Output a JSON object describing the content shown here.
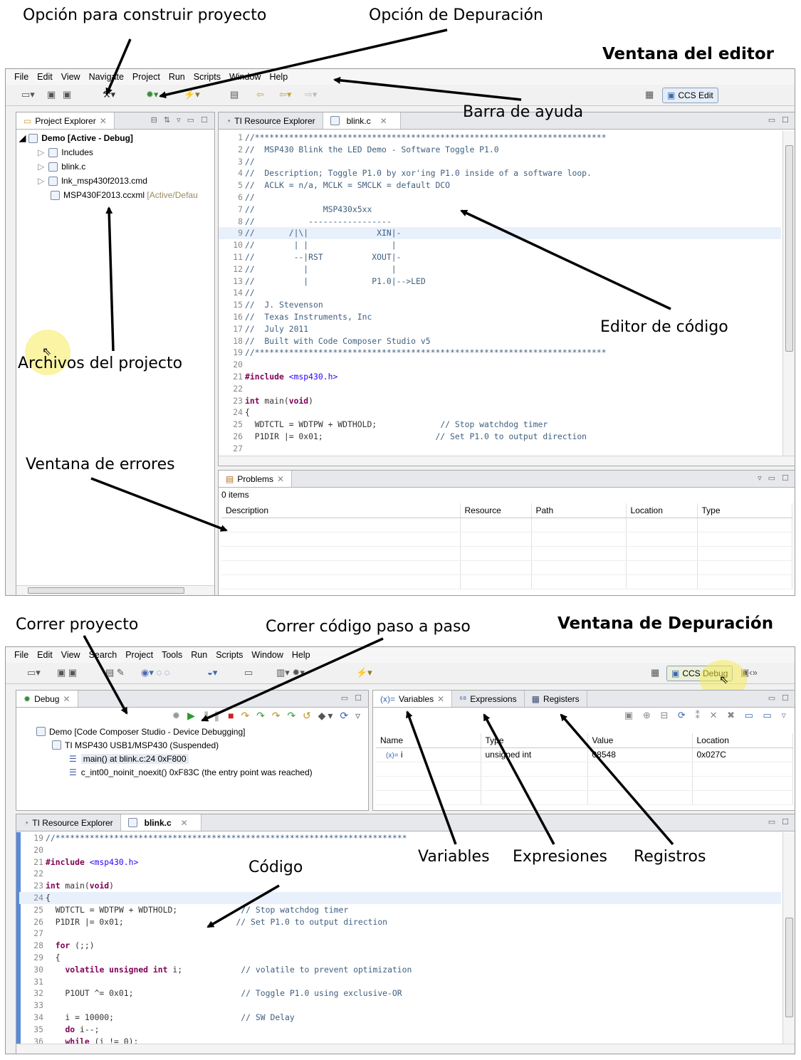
{
  "annotations": {
    "build_option": "Opción para construir proyecto",
    "debug_option": "Opción de Depuración",
    "editor_window": "Ventana del editor",
    "help_bar": "Barra de ayuda",
    "code_editor": "Editor de código",
    "project_files": "Archivos del projecto",
    "errors_window": "Ventana de errores",
    "run_project": "Correr proyecto",
    "step_code": "Correr código paso a paso",
    "debug_window": "Ventana de Depuración",
    "variables": "Variables",
    "expressions": "Expresiones",
    "registers": "Registros",
    "code": "Código"
  },
  "editor": {
    "menu": [
      "File",
      "Edit",
      "View",
      "Navigate",
      "Project",
      "Run",
      "Scripts",
      "Window",
      "Help"
    ],
    "perspective": "CCS Edit",
    "explorer_tab": "Project Explorer",
    "project_root": "Demo  [Active - Debug]",
    "tree": [
      "Includes",
      "blink.c",
      "lnk_msp430f2013.cmd",
      "MSP430F2013.ccxml"
    ],
    "tree_suffix": "[Active/Defau",
    "tab_resource": "TI Resource Explorer",
    "tab_file": "blink.c",
    "code_lines": [
      [
        "1",
        "//************************************************************************"
      ],
      [
        "2",
        "//  MSP430 Blink the LED Demo - Software Toggle P1.0"
      ],
      [
        "3",
        "//"
      ],
      [
        "4",
        "//  Description; Toggle P1.0 by xor'ing P1.0 inside of a software loop."
      ],
      [
        "5",
        "//  ACLK = n/a, MCLK = SMCLK = default DCO"
      ],
      [
        "6",
        "//"
      ],
      [
        "7",
        "//              MSP430x5xx"
      ],
      [
        "8",
        "//           -----------------"
      ],
      [
        "9",
        "//       /|\\|              XIN|-"
      ],
      [
        "10",
        "//        | |                 |"
      ],
      [
        "11",
        "//        --|RST          XOUT|-"
      ],
      [
        "12",
        "//          |                 |"
      ],
      [
        "13",
        "//          |             P1.0|-->LED"
      ],
      [
        "14",
        "//"
      ],
      [
        "15",
        "//  J. Stevenson"
      ],
      [
        "16",
        "//  Texas Instruments, Inc"
      ],
      [
        "17",
        "//  July 2011"
      ],
      [
        "18",
        "//  Built with Code Composer Studio v5"
      ],
      [
        "19",
        "//************************************************************************"
      ],
      [
        "20",
        ""
      ],
      [
        "21",
        "#include <msp430.h>"
      ],
      [
        "22",
        ""
      ],
      [
        "23",
        "int main(void)"
      ],
      [
        "24",
        "{"
      ],
      [
        "25",
        "  WDTCTL = WDTPW + WDTHOLD;             // Stop watchdog timer"
      ],
      [
        "26",
        "  P1DIR |= 0x01;                       // Set P1.0 to output direction"
      ],
      [
        "27",
        ""
      ]
    ],
    "problems_tab": "Problems",
    "problems_count": "0 items",
    "problems_cols": [
      "Description",
      "Resource",
      "Path",
      "Location",
      "Type"
    ]
  },
  "debug": {
    "menu": [
      "File",
      "Edit",
      "View",
      "Search",
      "Project",
      "Tools",
      "Run",
      "Scripts",
      "Window",
      "Help"
    ],
    "perspective": "CCS Debug",
    "debug_tab": "Debug",
    "tree": [
      "Demo [Code Composer Studio - Device Debugging]",
      "TI MSP430 USB1/MSP430 (Suspended)",
      "main() at blink.c:24 0xF800",
      "c_int00_noinit_noexit() 0xF83C  (the entry point was reached)"
    ],
    "tab_variables": "Variables",
    "tab_expressions": "Expressions",
    "tab_registers": "Registers",
    "var_cols": [
      "Name",
      "Type",
      "Value",
      "Location"
    ],
    "var_row": [
      "i",
      "unsigned int",
      "08548",
      "0x027C"
    ],
    "tab_resource": "TI Resource Explorer",
    "tab_file": "blink.c",
    "code_lines": [
      [
        "19",
        "//************************************************************************"
      ],
      [
        "20",
        ""
      ],
      [
        "21",
        "#include <msp430.h>"
      ],
      [
        "22",
        ""
      ],
      [
        "23",
        "int main(void)"
      ],
      [
        "24",
        "{"
      ],
      [
        "25",
        "  WDTCTL = WDTPW + WDTHOLD;             // Stop watchdog timer"
      ],
      [
        "26",
        "  P1DIR |= 0x01;                       // Set P1.0 to output direction"
      ],
      [
        "27",
        ""
      ],
      [
        "28",
        "  for (;;)"
      ],
      [
        "29",
        "  {"
      ],
      [
        "30",
        "    volatile unsigned int i;            // volatile to prevent optimization"
      ],
      [
        "31",
        ""
      ],
      [
        "32",
        "    P1OUT ^= 0x01;                      // Toggle P1.0 using exclusive-OR"
      ],
      [
        "33",
        ""
      ],
      [
        "34",
        "    i = 10000;                          // SW Delay"
      ],
      [
        "35",
        "    do i--;"
      ],
      [
        "36",
        "    while (i != 0);"
      ]
    ]
  }
}
